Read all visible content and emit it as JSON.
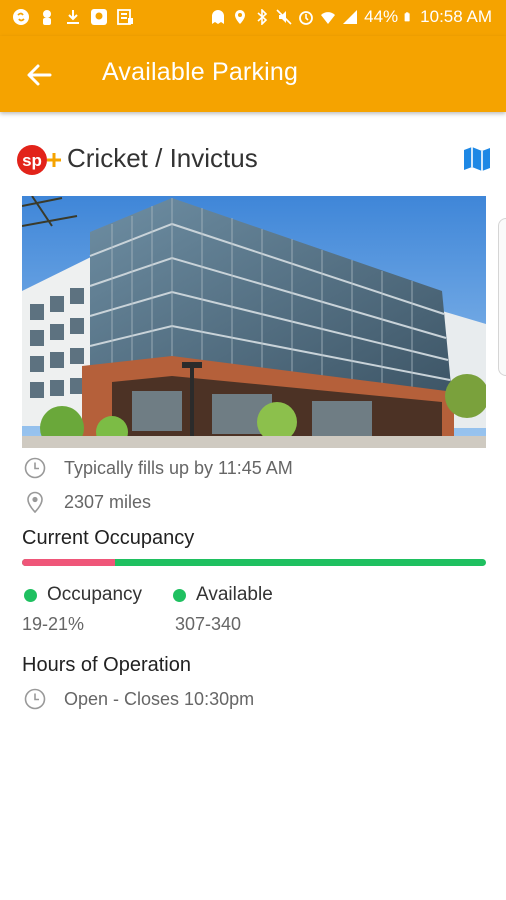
{
  "status_bar": {
    "battery": "44%",
    "time": "10:58 AM",
    "left_icons": [
      "shazam-icon",
      "notification-icon",
      "download-icon",
      "app-icon",
      "news-icon"
    ],
    "right_icons": [
      "ghost-icon",
      "location-icon",
      "bluetooth-icon",
      "mute-icon",
      "alarm-icon",
      "wifi-icon",
      "signal-icon",
      "battery-icon"
    ]
  },
  "app_bar": {
    "title": "Available Parking",
    "color": "#f5a300"
  },
  "lot": {
    "name": "Cricket / Invictus",
    "brand_logo": "sp-plus-logo"
  },
  "info": {
    "fills_up": "Typically fills up by 11:45 AM",
    "distance": "2307 miles"
  },
  "occupancy": {
    "title": "Current Occupancy",
    "occupied_fraction": 0.2,
    "occupancy_label": "Occupancy",
    "occupancy_value": "19-21%",
    "available_label": "Available",
    "available_value": "307-340",
    "colors": {
      "occupied": "#ef5679",
      "available": "#1fc060"
    }
  },
  "hours": {
    "title": "Hours of Operation",
    "status": "Open - Closes 10:30pm"
  }
}
